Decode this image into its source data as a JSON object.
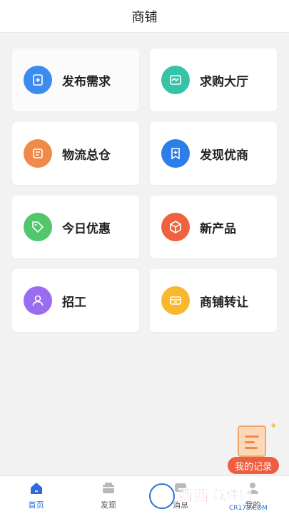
{
  "header": {
    "title": "商铺"
  },
  "cards": [
    {
      "label": "发布需求",
      "icon": "publish-icon",
      "color": "#3d8bef"
    },
    {
      "label": "求购大厅",
      "icon": "hall-icon",
      "color": "#35c4a8"
    },
    {
      "label": "物流总仓",
      "icon": "warehouse-icon",
      "color": "#f08a4b"
    },
    {
      "label": "发现优商",
      "icon": "bookmark-plus-icon",
      "color": "#2f7de8"
    },
    {
      "label": "今日优惠",
      "icon": "tag-icon",
      "color": "#52c66b"
    },
    {
      "label": "新产品",
      "icon": "box-icon",
      "color": "#f0623f"
    },
    {
      "label": "招工",
      "icon": "worker-icon",
      "color": "#9a6cf0"
    },
    {
      "label": "商铺转让",
      "icon": "shop-icon",
      "color": "#f7b82e"
    }
  ],
  "float_button": {
    "label": "我的记录",
    "color": "#ef5e3f"
  },
  "tabbar": {
    "tabs": [
      {
        "label": "首页",
        "active": true
      },
      {
        "label": "发现",
        "active": false
      },
      {
        "label": "消息",
        "active": false
      },
      {
        "label": "我的",
        "active": false
      }
    ],
    "active_color": "#2f6bdf"
  },
  "watermark": {
    "text1": "西西",
    "text2": "软件园",
    "text3": "CR173.COM"
  }
}
